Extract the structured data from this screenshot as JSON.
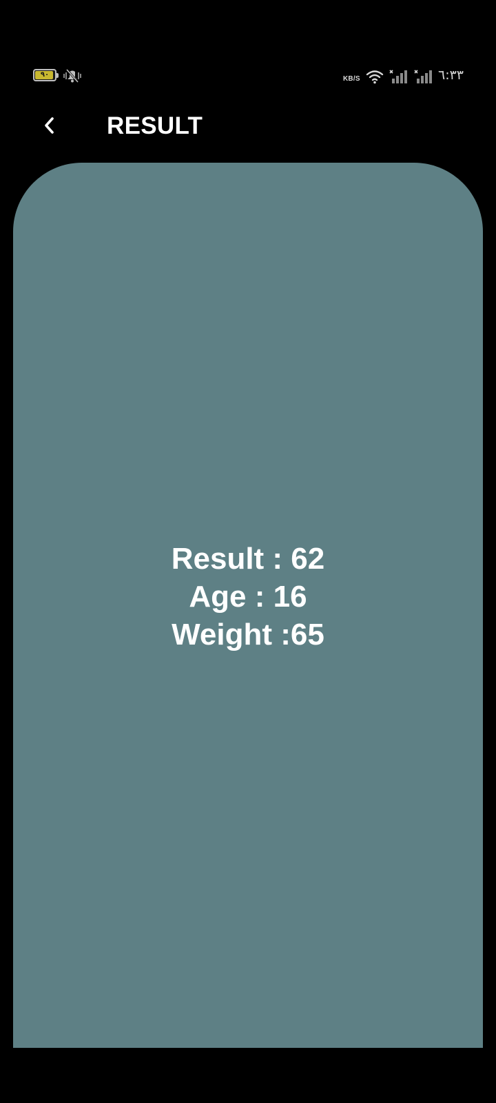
{
  "status_bar": {
    "battery_level": "٩٠",
    "net_speed": "KB/S",
    "time": "٦:٣٣",
    "icons": [
      "battery-icon",
      "mute-icon",
      "wifi-icon",
      "signal-icon",
      "signal-icon"
    ],
    "battery_color": "#c8b830"
  },
  "app_bar": {
    "title": "RESULT",
    "back_icon": "chevron-left-icon"
  },
  "result_card": {
    "background_color": "#5e8085",
    "lines": [
      "Result : 62",
      "Age : 16",
      "Weight :65"
    ]
  }
}
